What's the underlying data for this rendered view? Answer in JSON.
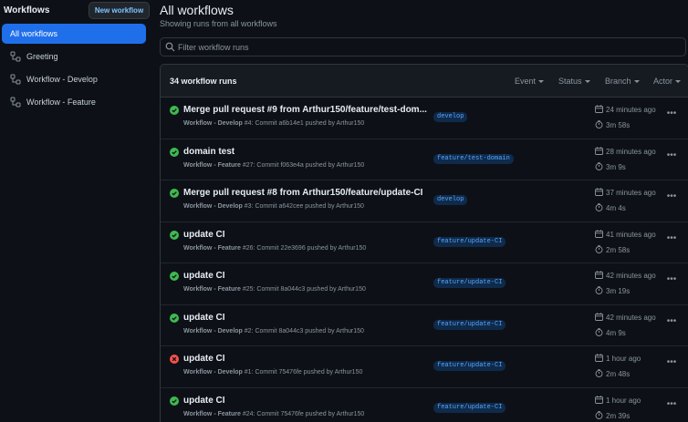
{
  "sidebar": {
    "title": "Workflows",
    "new_button": "New workflow",
    "items": [
      {
        "label": "All workflows",
        "active": true
      },
      {
        "label": "Greeting",
        "icon": "workflow-icon"
      },
      {
        "label": "Workflow - Develop",
        "icon": "workflow-icon"
      },
      {
        "label": "Workflow - Feature",
        "icon": "workflow-icon"
      }
    ]
  },
  "main": {
    "title": "All workflows",
    "subtitle": "Showing runs from all workflows",
    "filter_placeholder": "Filter workflow runs",
    "runs_count": "34 workflow runs",
    "filters": [
      "Event",
      "Status",
      "Branch",
      "Actor"
    ]
  },
  "colors": {
    "success": "#3fb950",
    "failure": "#f85149",
    "accent": "#1f6feb",
    "branch_text": "#58a6ff"
  },
  "runs": [
    {
      "status": "success",
      "title": "Merge pull request #9 from Arthur150/feature/test-dom...",
      "workflow": "Workflow - Develop",
      "meta": " #4: Commit a6b14e1 pushed by Arthur150",
      "branch": "develop",
      "when": "24 minutes ago",
      "duration": "3m 58s"
    },
    {
      "status": "success",
      "title": "domain test",
      "workflow": "Workflow - Feature",
      "meta": " #27: Commit f063e4a pushed by Arthur150",
      "branch": "feature/test-domain",
      "when": "28 minutes ago",
      "duration": "3m 9s"
    },
    {
      "status": "success",
      "title": "Merge pull request #8 from Arthur150/feature/update-CI",
      "workflow": "Workflow - Develop",
      "meta": " #3: Commit a642cee pushed by Arthur150",
      "branch": "develop",
      "when": "37 minutes ago",
      "duration": "4m 4s"
    },
    {
      "status": "success",
      "title": "update CI",
      "workflow": "Workflow - Feature",
      "meta": " #26: Commit 22e3696 pushed by Arthur150",
      "branch": "feature/update-CI",
      "when": "41 minutes ago",
      "duration": "2m 58s"
    },
    {
      "status": "success",
      "title": "update CI",
      "workflow": "Workflow - Feature",
      "meta": " #25: Commit 8a044c3 pushed by Arthur150",
      "branch": "feature/update-CI",
      "when": "42 minutes ago",
      "duration": "3m 19s"
    },
    {
      "status": "success",
      "title": "update CI",
      "workflow": "Workflow - Develop",
      "meta": " #2: Commit 8a044c3 pushed by Arthur150",
      "branch": "feature/update-CI",
      "when": "42 minutes ago",
      "duration": "4m 9s"
    },
    {
      "status": "failure",
      "title": "update CI",
      "workflow": "Workflow - Develop",
      "meta": " #1: Commit 75476fe pushed by Arthur150",
      "branch": "feature/update-CI",
      "when": "1 hour ago",
      "duration": "2m 48s"
    },
    {
      "status": "success",
      "title": "update CI",
      "workflow": "Workflow - Feature",
      "meta": " #24: Commit 75476fe pushed by Arthur150",
      "branch": "feature/update-CI",
      "when": "1 hour ago",
      "duration": "2m 39s"
    }
  ]
}
